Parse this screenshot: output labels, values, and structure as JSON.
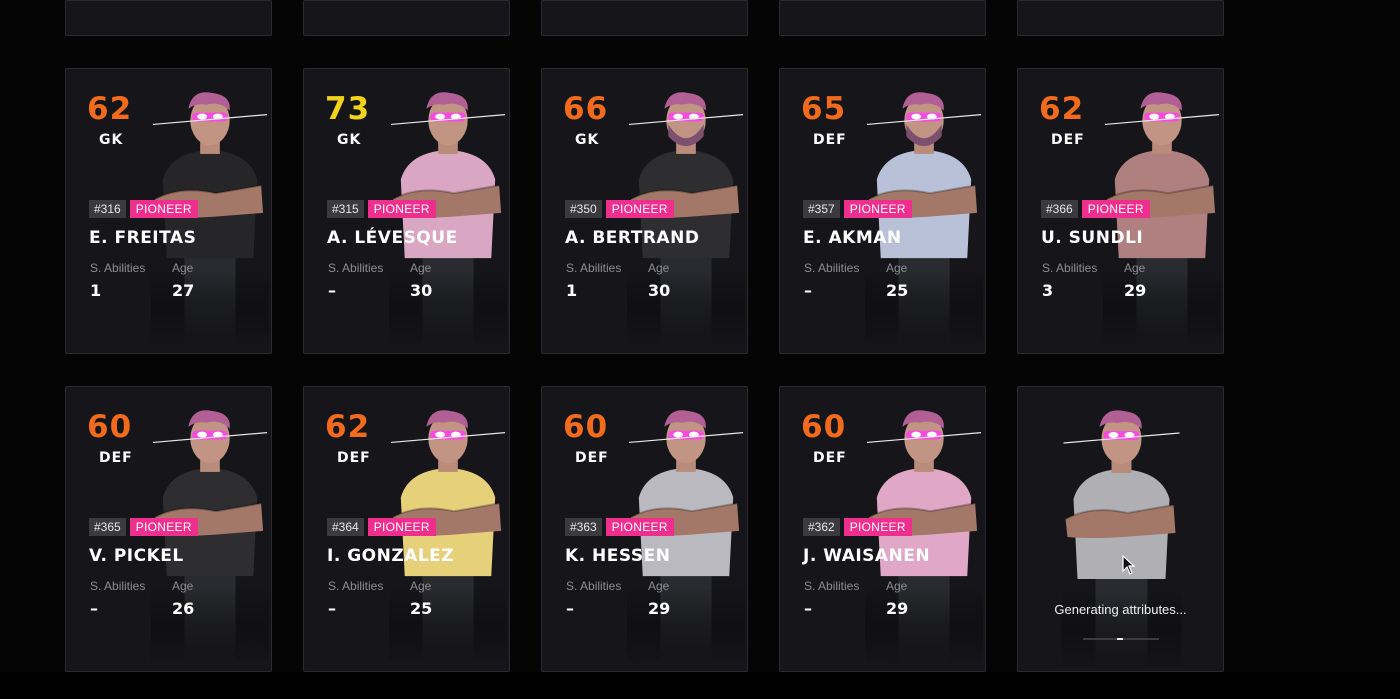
{
  "badge_label": "PIONEER",
  "labels": {
    "abilities": "S. Abilities",
    "age": "Age"
  },
  "colors": {
    "orange": "#f26b1d",
    "yellow": "#f2d31b",
    "badge": "#ef2f8d"
  },
  "ghost_cards": 5,
  "cards": [
    {
      "rating": "62",
      "color": "orange",
      "pos": "GK",
      "id": "#316",
      "name": "E. FREITAS",
      "abilities": "1",
      "age": "27",
      "shirt": "#262628",
      "beard": false
    },
    {
      "rating": "73",
      "color": "yellow",
      "pos": "GK",
      "id": "#315",
      "name": "A. LÉVESQUE",
      "abilities": "–",
      "age": "30",
      "shirt": "#d9a6c4",
      "beard": false
    },
    {
      "rating": "66",
      "color": "orange",
      "pos": "GK",
      "id": "#350",
      "name": "A. BERTRAND",
      "abilities": "1",
      "age": "30",
      "shirt": "#2e2e31",
      "beard": true
    },
    {
      "rating": "65",
      "color": "orange",
      "pos": "DEF",
      "id": "#357",
      "name": "E. AKMAN",
      "abilities": "–",
      "age": "25",
      "shirt": "#b8c1d8",
      "beard": true
    },
    {
      "rating": "62",
      "color": "orange",
      "pos": "DEF",
      "id": "#366",
      "name": "U. SUNDLI",
      "abilities": "3",
      "age": "29",
      "shirt": "#b07f80",
      "beard": false
    },
    {
      "rating": "60",
      "color": "orange",
      "pos": "DEF",
      "id": "#365",
      "name": "V. PICKEL",
      "abilities": "–",
      "age": "26",
      "shirt": "#2e2e31",
      "beard": false
    },
    {
      "rating": "62",
      "color": "orange",
      "pos": "DEF",
      "id": "#364",
      "name": "I. GONZALEZ",
      "abilities": "–",
      "age": "25",
      "shirt": "#e6d07a",
      "beard": false
    },
    {
      "rating": "60",
      "color": "orange",
      "pos": "DEF",
      "id": "#363",
      "name": "K. HESSEN",
      "abilities": "–",
      "age": "29",
      "shirt": "#b9b9bf",
      "beard": false
    },
    {
      "rating": "60",
      "color": "orange",
      "pos": "DEF",
      "id": "#362",
      "name": "J. WAISANEN",
      "abilities": "–",
      "age": "29",
      "shirt": "#e0a7c6",
      "beard": false
    }
  ],
  "generating": {
    "text": "Generating attributes...",
    "progress": 0.1
  }
}
